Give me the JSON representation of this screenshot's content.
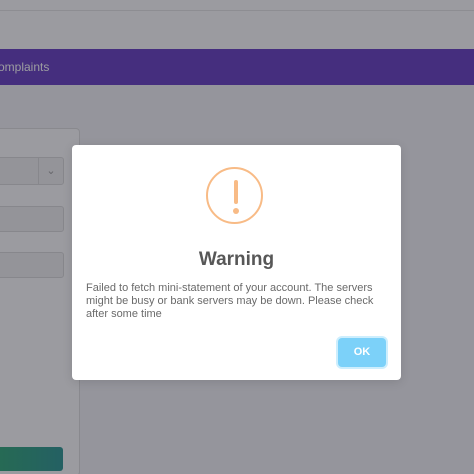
{
  "navbar": {
    "link_label": "omplaints",
    "background": "#5b2fbf"
  },
  "form": {
    "select_icon": "chevron-down-icon"
  },
  "dialog": {
    "icon": "warning-icon",
    "icon_color": "#f8bb86",
    "title": "Warning",
    "message_lines": [
      "Failed to fetch mini-statement of your account. The servers",
      "might be busy or bank servers may be down. Please check",
      "after some time"
    ],
    "ok_label": "OK",
    "ok_color": "#7cd1f9"
  }
}
